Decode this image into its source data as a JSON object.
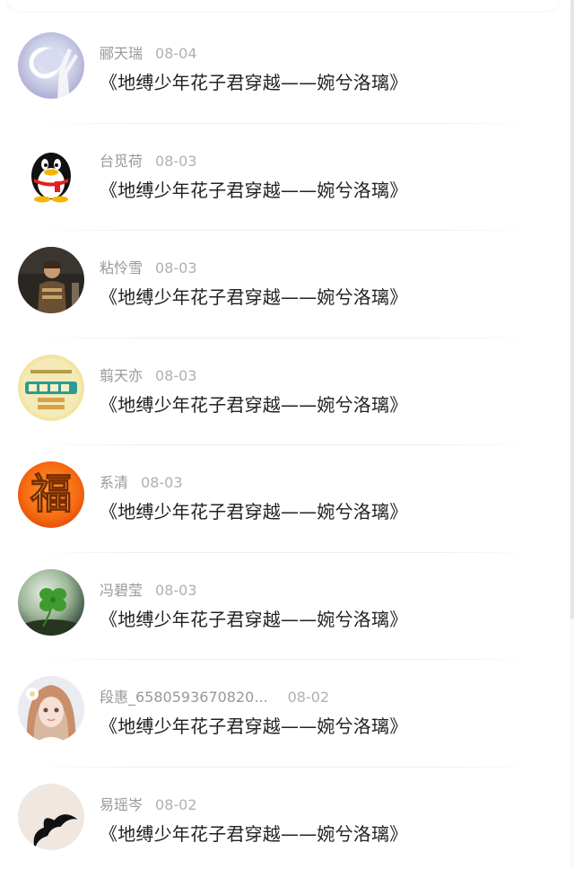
{
  "items": [
    {
      "name": "郦天瑞",
      "time": "08-04",
      "title": "《地缚少年花子君穿越——婉兮洛璃》",
      "avatar": "moon-hand-avatar"
    },
    {
      "name": "台觅荷",
      "time": "08-03",
      "title": "《地缚少年花子君穿越——婉兮洛璃》",
      "avatar": "penguin-avatar"
    },
    {
      "name": "粘怜雪",
      "time": "08-03",
      "title": "《地缚少年花子君穿越——婉兮洛璃》",
      "avatar": "child-photo-avatar"
    },
    {
      "name": "翦天亦",
      "time": "08-03",
      "title": "《地缚少年花子君穿越——婉兮洛璃》",
      "avatar": "badge-text-avatar"
    },
    {
      "name": "系清",
      "time": "08-03",
      "title": "《地缚少年花子君穿越——婉兮洛璃》",
      "avatar": "fu-character-avatar",
      "fu": "福"
    },
    {
      "name": "冯碧莹",
      "time": "08-03",
      "title": "《地缚少年花子君穿越——婉兮洛璃》",
      "avatar": "clover-avatar"
    },
    {
      "name": "段惠_6580593670820...",
      "time": "08-02",
      "title": "《地缚少年花子君穿越——婉兮洛璃》",
      "avatar": "girl-portrait-avatar"
    },
    {
      "name": "易瑶岑",
      "time": "08-02",
      "title": "《地缚少年花子君穿越——婉兮洛璃》",
      "avatar": "mustache-avatar"
    }
  ]
}
